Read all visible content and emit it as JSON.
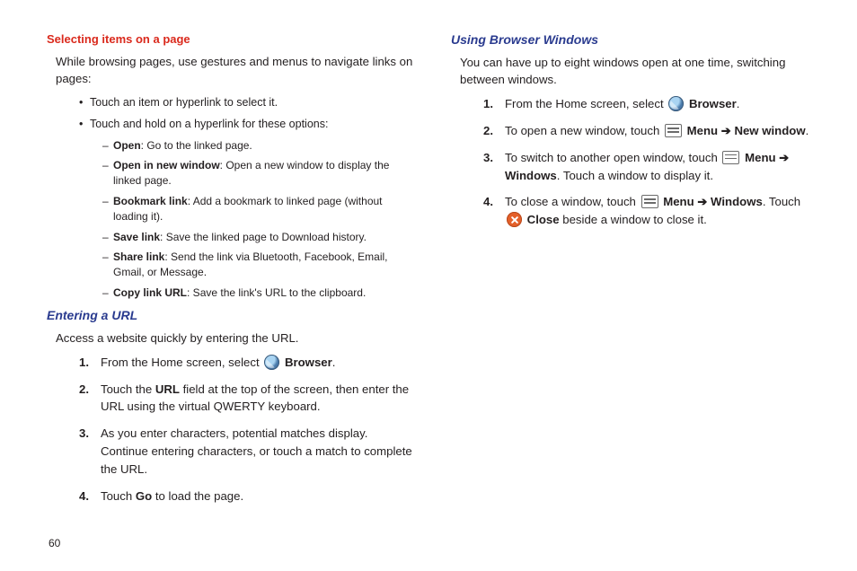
{
  "pageNumber": "60",
  "left": {
    "h1": "Selecting items on a page",
    "intro": "While browsing pages, use gestures and menus to navigate links on pages:",
    "bullets": [
      {
        "text": "Touch an item or hyperlink to select it."
      },
      {
        "text": "Touch and hold on a hyperlink for these options:",
        "sub": [
          {
            "b": "Open",
            "rest": ": Go to the linked page."
          },
          {
            "b": "Open in new window",
            "rest": ": Open a new window to display the linked page."
          },
          {
            "b": "Bookmark link",
            "rest": ": Add a bookmark to linked page (without loading it)."
          },
          {
            "b": "Save link",
            "rest": ": Save the linked page to Download history."
          },
          {
            "b": "Share link",
            "rest": ": Send the link via Bluetooth, Facebook, Email, Gmail, or Message."
          },
          {
            "b": "Copy link URL",
            "rest": ": Save the link's URL to the clipboard."
          }
        ]
      }
    ],
    "h2": "Entering a URL",
    "intro2": "Access a website quickly by entering the URL.",
    "steps": {
      "s1_a": "From the Home screen, select ",
      "s1_b": "Browser",
      "s1_c": ".",
      "s2_a": "Touch the ",
      "s2_b": "URL",
      "s2_c": " field at the top of the screen, then enter the URL using the virtual QWERTY keyboard.",
      "s3": "As you enter characters, potential matches display. Continue entering characters, or touch a match to complete the URL.",
      "s4_a": "Touch ",
      "s4_b": "Go",
      "s4_c": " to load the page."
    }
  },
  "right": {
    "h1": "Using Browser Windows",
    "intro": "You can have up to eight windows open at one time, switching between windows.",
    "s1_a": "From the Home screen, select ",
    "s1_b": "Browser",
    "s1_c": ".",
    "s2_a": "To open a new window, touch ",
    "s2_menu": "Menu",
    "arrow": " ➔ ",
    "s2_b": "New window",
    "s2_c": ".",
    "s3_a": "To switch to another open window, touch ",
    "s3_menu": "Menu",
    "s3_b": "Windows",
    "s3_c": ". Touch a window to display it.",
    "s4_a": "To close a window, touch ",
    "s4_menu": "Menu",
    "s4_b": "Windows",
    "s4_c": ". Touch ",
    "s4_close": "Close",
    "s4_d": " beside a window to close it."
  }
}
